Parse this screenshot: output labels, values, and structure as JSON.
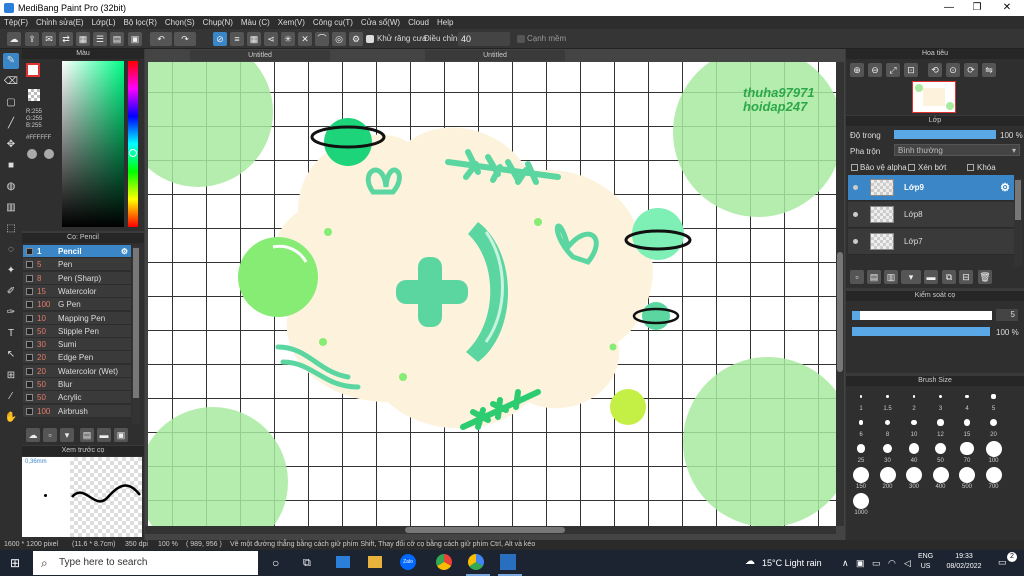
{
  "window": {
    "title": "MediBang Paint Pro (32bit)",
    "min": "—",
    "max": "❐",
    "close": "✕"
  },
  "menu": [
    "Tệp(F)",
    "Chỉnh sửa(E)",
    "Lớp(L)",
    "Bộ lọc(R)",
    "Chọn(S)",
    "Chụp(N)",
    "Màu (C)",
    "Xem(V)",
    "Công cụ(T)",
    "Cửa sổ(W)",
    "Cloud",
    "Help"
  ],
  "toolbar": {
    "antialias": "Khử răng cưa",
    "adjust": "Điều chỉnh",
    "adjust_value": "40",
    "soft": "Cạnh mềm"
  },
  "color_panel": {
    "title": "Màu",
    "r": "R:255",
    "g": "G:255",
    "b": "B:255",
    "hex": "#FFFFFF"
  },
  "brush_panel": {
    "title": "Cọ: Pencil",
    "items": [
      {
        "n": "1",
        "name": "Pencil"
      },
      {
        "n": "5",
        "name": "Pen"
      },
      {
        "n": "8",
        "name": "Pen (Sharp)"
      },
      {
        "n": "15",
        "name": "Watercolor"
      },
      {
        "n": "100",
        "name": "G Pen"
      },
      {
        "n": "10",
        "name": "Mapping Pen"
      },
      {
        "n": "50",
        "name": "Stipple Pen"
      },
      {
        "n": "30",
        "name": "Sumi"
      },
      {
        "n": "20",
        "name": "Edge Pen"
      },
      {
        "n": "20",
        "name": "Watercolor (Wet)"
      },
      {
        "n": "50",
        "name": "Blur"
      },
      {
        "n": "50",
        "name": "Acrylic"
      },
      {
        "n": "100",
        "name": "Airbrush"
      }
    ]
  },
  "preview_panel": {
    "title": "Xem trước cọ",
    "size": "0,36mm"
  },
  "tabs": {
    "a": "Untitled",
    "b": "Untitled"
  },
  "watermark": {
    "line1": "thuha97971",
    "line2": "hoidap247"
  },
  "navigator": {
    "title": "Hoa tiêu"
  },
  "layer_panel": {
    "title": "Lớp",
    "opacity_label": "Độ trong",
    "opacity": "100 %",
    "opacity_level": 100,
    "blend_label": "Pha trộn",
    "blend": "Bình thường",
    "protect": "Bảo vệ alpha",
    "clip": "Xén bớt",
    "lock": "Khóa",
    "layers": [
      "Lớp9",
      "Lớp8",
      "Lớp7"
    ]
  },
  "brush_control": {
    "title": "Kiểm soát cọ",
    "size": "5",
    "opacity": "100 %",
    "size_level": 0.03,
    "opacity_level": 100
  },
  "brush_size": {
    "title": "Brush Size",
    "sizes": [
      "1",
      "1.5",
      "2",
      "3",
      "4",
      "5",
      "6",
      "8",
      "10",
      "12",
      "15",
      "20",
      "25",
      "30",
      "40",
      "50",
      "70",
      "100",
      "150",
      "200",
      "300",
      "400",
      "500",
      "700",
      "1000"
    ]
  },
  "status": {
    "dims": "1600 * 1200 pixel",
    "cm": "(11.6 * 8.7cm)",
    "dpi": "350 dpi",
    "zoom": "100 %",
    "coords": "( 989, 956 )",
    "hint": "Vẽ một đường thẳng bằng cách giữ phím Shift, Thay đổi cỡ cọ bằng cách giữ phím Ctrl, Alt và kéo"
  },
  "taskbar": {
    "search": "Type here to search",
    "weather": "15°C  Light rain",
    "lang1": "ENG",
    "lang2": "US",
    "time": "19:33",
    "date": "08/02/2022",
    "notif": "2"
  },
  "colors": {
    "accent": "#3b86c6",
    "mint": "#5cd6a0",
    "lightgreen": "#a8eaa0",
    "cream": "#fdf3dd",
    "dark": "#2b2b2b"
  }
}
